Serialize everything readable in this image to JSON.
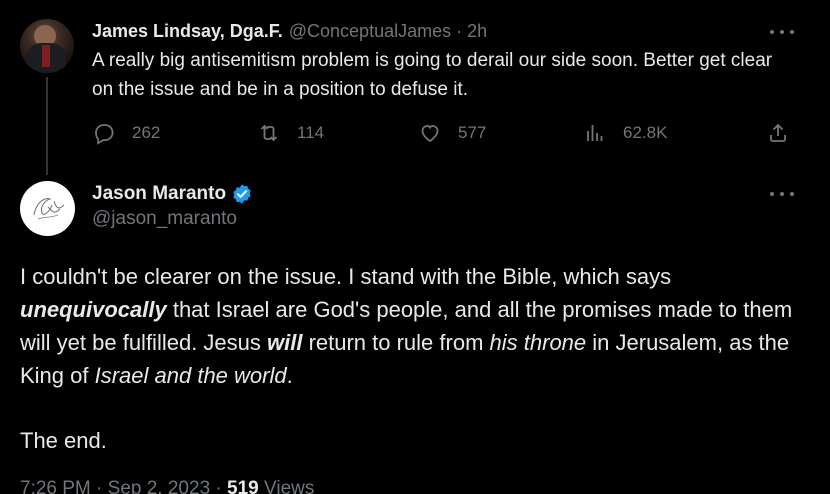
{
  "tweet1": {
    "author_name": "James Lindsay, Dga.F.",
    "handle": "@ConceptualJames",
    "separator": "·",
    "time": "2h",
    "text": "A really big antisemitism problem is going to derail our side soon. Better get clear on the issue and be in a position to defuse it.",
    "stats": {
      "replies": "262",
      "reposts": "114",
      "likes": "577",
      "views": "62.8K"
    }
  },
  "tweet2": {
    "author_name": "Jason Maranto",
    "handle": "@jason_maranto",
    "verified": true,
    "text_parts": {
      "p1": "I couldn't be clearer on the issue. I stand with the Bible, which says ",
      "p2": "unequivocally",
      "p3": " that Israel are God's people, and all the promises made to them will yet be fulfilled. Jesus ",
      "p4": "will",
      "p5": " return to rule from ",
      "p6": "his throne",
      "p7": " in Jerusalem, as the King of ",
      "p8": "Israel and the world",
      "p9": "."
    },
    "text_end": "The end.",
    "meta": {
      "time": "7:26 PM",
      "sep1": "·",
      "date": "Sep 2, 2023",
      "sep2": "·",
      "views_count": "519",
      "views_label": "Views"
    }
  },
  "colors": {
    "background": "#000000",
    "text": "#e7e9ea",
    "muted": "#71767b",
    "verified": "#1d9bf0",
    "thread_line": "#333639"
  },
  "icons": [
    "reply-icon",
    "repost-icon",
    "like-icon",
    "views-icon",
    "share-icon",
    "more-icon",
    "verified-badge-icon"
  ]
}
